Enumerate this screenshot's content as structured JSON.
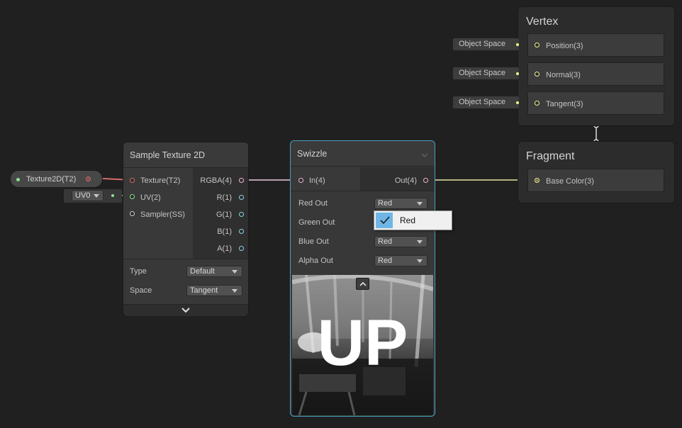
{
  "property_node": {
    "label": "Texture2D(T2)",
    "uv_dropdown": "UV0"
  },
  "sample_texture": {
    "title": "Sample Texture 2D",
    "inputs": [
      "Texture(T2)",
      "UV(2)",
      "Sampler(SS)"
    ],
    "outputs": [
      "RGBA(4)",
      "R(1)",
      "G(1)",
      "B(1)",
      "A(1)"
    ],
    "settings": [
      {
        "label": "Type",
        "value": "Default"
      },
      {
        "label": "Space",
        "value": "Tangent"
      }
    ]
  },
  "swizzle": {
    "title": "Swizzle",
    "input": "In(4)",
    "output": "Out(4)",
    "rows": [
      {
        "label": "Red Out",
        "value": "Red"
      },
      {
        "label": "Green Out",
        "value": "Red"
      },
      {
        "label": "Blue Out",
        "value": "Red"
      },
      {
        "label": "Alpha Out",
        "value": "Red"
      }
    ],
    "dropdown_popup": {
      "selected": "Red"
    },
    "preview_text": "UP"
  },
  "vertex": {
    "title": "Vertex",
    "blocks": [
      {
        "label": "Position(3)",
        "space": "Object Space"
      },
      {
        "label": "Normal(3)",
        "space": "Object Space"
      },
      {
        "label": "Tangent(3)",
        "space": "Object Space"
      }
    ]
  },
  "fragment": {
    "title": "Fragment",
    "blocks": [
      {
        "label": "Base Color(3)"
      }
    ]
  },
  "colors": {
    "background": "#202020",
    "texture_port": "#e06a6a",
    "vector2_port": "#8ee08e",
    "vector4_port": "#f4b8d8",
    "float_port": "#8ed6e6",
    "vector3_port": "#f4f48e",
    "selection_blue": "#6fb6e6"
  }
}
